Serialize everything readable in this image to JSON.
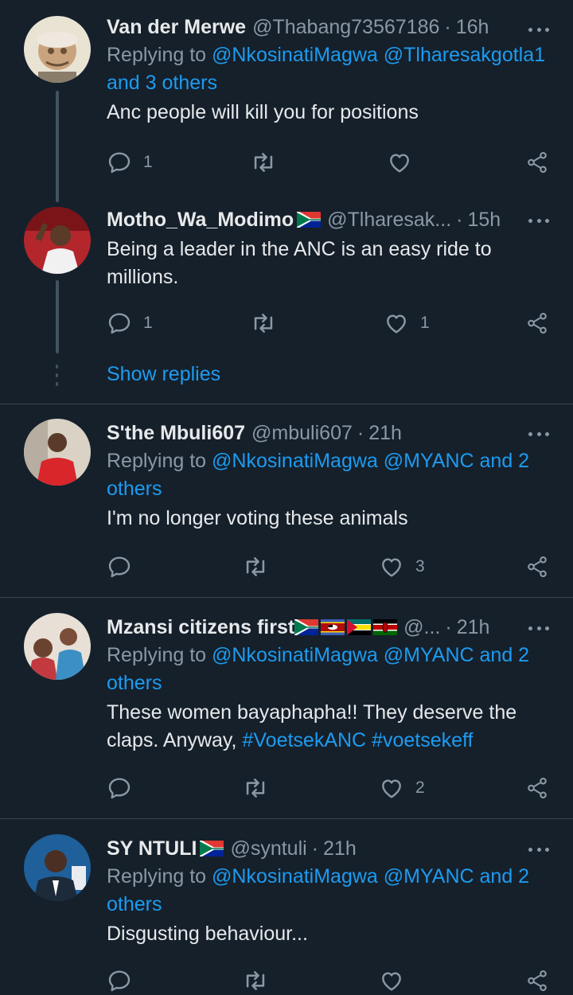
{
  "tweets": [
    {
      "name": "Van der Merwe",
      "handle": "@Thabang73567186",
      "time": "16h",
      "replying_prefix": "Replying to",
      "replying_line1": "@NkosinatiMagwa @Tlharesakgotla1",
      "replying_line2": "and 3 others",
      "text": "Anc people will kill you for positions",
      "replies": "1",
      "retweets": "",
      "likes": ""
    },
    {
      "name": "Motho_Wa_Modimo",
      "handle": "@Tlharesak...",
      "time": "15h",
      "text_line1": "Being a leader in the ANC is an easy ride to",
      "text_line2": "millions.",
      "replies": "1",
      "retweets": "",
      "likes": "1"
    },
    {
      "name": "S'the Mbuli607",
      "handle": "@mbuli607",
      "time": "21h",
      "replying_prefix": "Replying to",
      "replying_line1": "@NkosinatiMagwa @MYANC and 2",
      "replying_line2": "others",
      "text": "I'm no longer voting these animals",
      "replies": "",
      "retweets": "",
      "likes": "3"
    },
    {
      "name": "Mzansi citizens first",
      "handle": "@...",
      "time": "21h",
      "replying_prefix": "Replying to",
      "replying_line1": "@NkosinatiMagwa @MYANC and 2",
      "replying_line2": "others",
      "text_line1": "These women bayaphapha!! They deserve the",
      "text_line2_prefix": "claps. Anyway,",
      "hashtag1": "#VoetsekANC",
      "hashtag2": "#voetsekeff",
      "replies": "",
      "retweets": "",
      "likes": "2"
    },
    {
      "name": "SY NTULI",
      "handle": "@syntuli",
      "time": "21h",
      "replying_prefix": "Replying to",
      "replying_line1": "@NkosinatiMagwa @MYANC and 2",
      "replying_line2": "others",
      "text": "Disgusting behaviour..."
    }
  ],
  "show_replies": "Show replies",
  "separator": "·",
  "icons": {
    "reply": "reply-icon",
    "retweet": "retweet-icon",
    "like": "like-icon",
    "share": "share-icon",
    "more": "more-icon"
  },
  "colors": {
    "background": "#15202b",
    "accent": "#1d9bf0",
    "muted": "#8b98a5",
    "text": "#e7e9ea"
  }
}
